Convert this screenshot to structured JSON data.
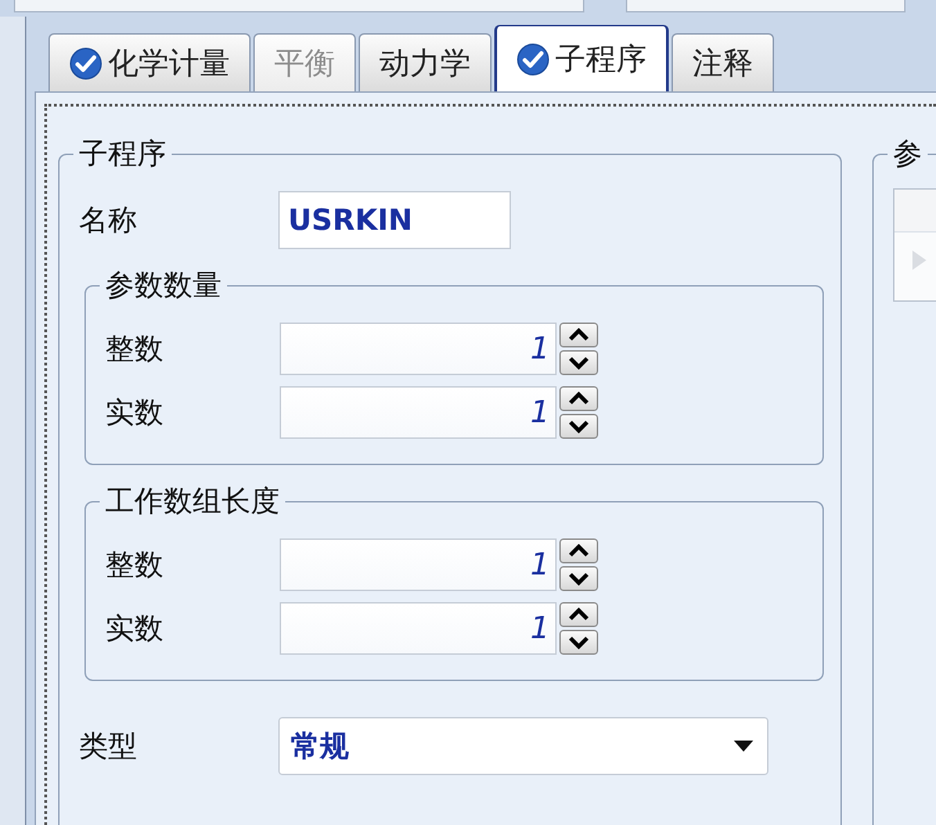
{
  "tabs": [
    {
      "label": "化学计量",
      "complete": true,
      "selected": false,
      "disabled": false
    },
    {
      "label": "平衡",
      "complete": false,
      "selected": false,
      "disabled": true
    },
    {
      "label": "动力学",
      "complete": false,
      "selected": false,
      "disabled": false
    },
    {
      "label": "子程序",
      "complete": true,
      "selected": true,
      "disabled": false
    },
    {
      "label": "注释",
      "complete": false,
      "selected": false,
      "disabled": false
    }
  ],
  "subroutine": {
    "title": "子程序",
    "name_label": "名称",
    "name_value": "USRKIN",
    "groups": [
      {
        "title": "参数数量",
        "fields": [
          {
            "label": "整数",
            "value": "1"
          },
          {
            "label": "实数",
            "value": "1"
          }
        ]
      },
      {
        "title": "工作数组长度",
        "fields": [
          {
            "label": "整数",
            "value": "1"
          },
          {
            "label": "实数",
            "value": "1"
          }
        ]
      }
    ],
    "type_label": "类型",
    "type_value": "常规"
  },
  "parameters_panel": {
    "title": "参"
  }
}
